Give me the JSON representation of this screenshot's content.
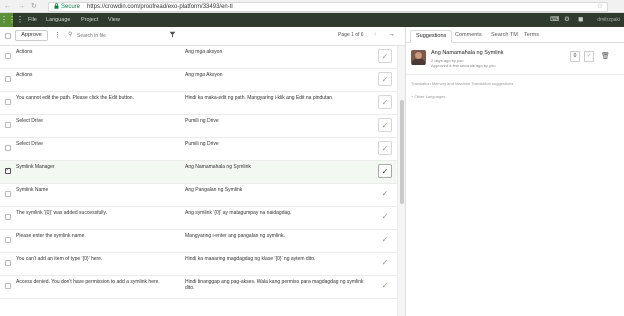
{
  "browser": {
    "back_icon": "←",
    "forward_icon": "→",
    "reload_icon": "↻",
    "lock_icon": "lock",
    "secure_label": "Secure",
    "url": "https://crowdin.com/proofread/exo-platform/33493/en-tl",
    "star_icon": "☆"
  },
  "appbar": {
    "menu": [
      "File",
      "Language",
      "Project",
      "View"
    ],
    "username": "dmitrzpaki"
  },
  "toolbar": {
    "approve_label": "Approve",
    "search_placeholder": "Search in file",
    "page_info": "Page 1 of 6",
    "prev_icon": "‹",
    "next_icon": "→"
  },
  "rows": [
    {
      "source": "Actions",
      "translation": "Ang mga aksyon",
      "approved": true,
      "boxed": true
    },
    {
      "source": "Actions",
      "translation": "Ang mga Aksyon",
      "approved": true,
      "boxed": true
    },
    {
      "source": "You cannot edit the path. Please click the Edit button.",
      "translation": "Hindi ka maka-edit ng path. Mangyaring i-klik ang Edit na pindutan.",
      "approved": true,
      "boxed": true
    },
    {
      "source": "Select Drive",
      "translation": "Pumili ng Drive",
      "approved": true,
      "boxed": true
    },
    {
      "source": "Select Drive",
      "translation": "Pumili ng Drive",
      "approved": true,
      "boxed": true
    },
    {
      "source": "Symlink Manager",
      "translation": "Ang Namamahala ng Symlink",
      "approved": true,
      "boxed": true,
      "active": true,
      "checked": true
    },
    {
      "source": "Symlink Name",
      "translation": "Ang Pangalan ng Symlink",
      "approved": true,
      "boxed": false
    },
    {
      "source": "The symlink '{0}' was added successfully.",
      "translation": "Ang symlink '{0}' ay matagumpay na naidagdag.",
      "approved": true,
      "boxed": false
    },
    {
      "source": "Please enter the symlink name.",
      "translation": "Mangyaring i-enter ang pangalan ng symlink.",
      "approved": true,
      "boxed": false
    },
    {
      "source": "You can't add an item of type '{0}' here.",
      "translation": "Hindi ka maaaring magdagdag ng klase '{0}' ng aytem dito.",
      "approved": true,
      "boxed": false
    },
    {
      "source": "Access denied. You don't have permission to add a symlink here.",
      "translation": "Hindi tinanggap ang pag-akses. Wala kang permiso para magdagdag ng symlink dito.",
      "approved": true,
      "boxed": false
    }
  ],
  "panel": {
    "tabs": [
      "Suggestions",
      "Comments",
      "Search TM",
      "Terms"
    ],
    "active_tab": 0,
    "suggestion": {
      "text": "Ang Namamahala ng Symlink",
      "meta1": "2 days ago by you",
      "meta2": "Approved a few seconds ago by you",
      "votes": "0"
    },
    "tm_label": "Translation Memory and Machine Translation suggestions",
    "other_languages": "+ Other Languages"
  },
  "colors": {
    "appbar": "#2f3b2c",
    "grid": "#5b8f3a",
    "secure": "#0b8043"
  }
}
